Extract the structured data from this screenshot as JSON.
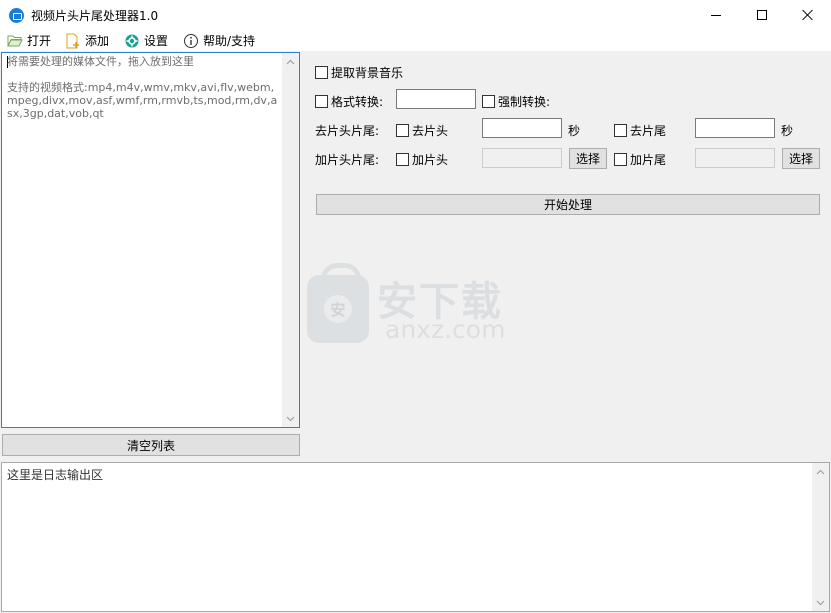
{
  "window": {
    "title": "视频片头片尾处理器1.0",
    "icon": "app-icon"
  },
  "menu": {
    "open": {
      "label": "打开",
      "icon": "folder-open-icon"
    },
    "add": {
      "label": "添加",
      "icon": "file-add-icon"
    },
    "settings": {
      "label": "设置",
      "icon": "gear-icon"
    },
    "help": {
      "label": "帮助/支持",
      "icon": "info-icon"
    }
  },
  "file_list": {
    "text": "将需要处理的媒体文件，拖入放到这里\n\n支持的视频格式:mp4,m4v,wmv,mkv,avi,flv,webm,mpeg,divx,mov,asf,wmf,rm,rmvb,ts,mod,rm,dv,asx,3gp,dat,vob,qt"
  },
  "clear_button": "清空列表",
  "options": {
    "extract_bgm": "提取背景音乐",
    "format_convert": "格式转换:",
    "format_value": "",
    "force_convert": "强制转换:",
    "remove_row_label": "去片头片尾:",
    "remove_head": "去片头",
    "remove_head_value": "",
    "remove_tail": "去片尾",
    "remove_tail_value": "",
    "seconds": "秒",
    "add_row_label": "加片头片尾:",
    "add_head": "加片头",
    "add_tail": "加片尾",
    "choose": "选择"
  },
  "start_button": "开始处理",
  "watermark": {
    "cn": "安下载",
    "en": "anxz.com",
    "badge": "安"
  },
  "log": {
    "text": "这里是日志输出区"
  }
}
